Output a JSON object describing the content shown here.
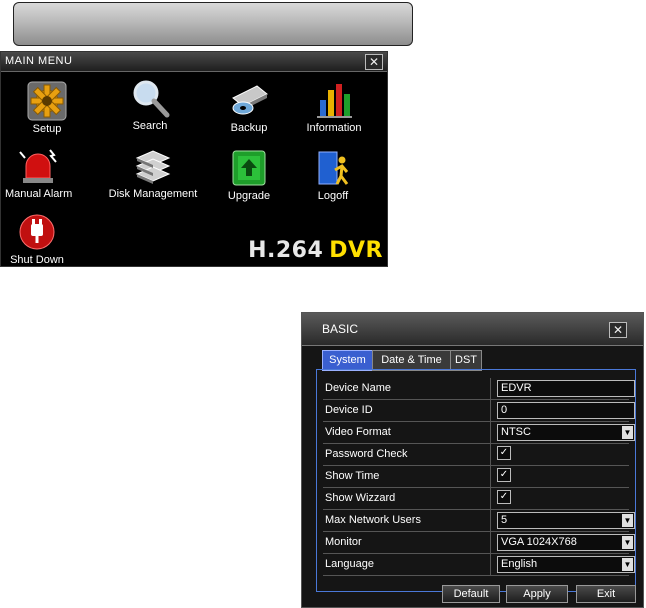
{
  "main_menu": {
    "title": "MAIN MENU",
    "close_glyph": "✕",
    "items": [
      {
        "label": "Setup",
        "icon": "gear-icon"
      },
      {
        "label": "Search",
        "icon": "magnifier-icon"
      },
      {
        "label": "Backup",
        "icon": "backup-disc-icon"
      },
      {
        "label": "Information",
        "icon": "bar-chart-icon"
      },
      {
        "label": "Manual Alarm",
        "icon": "siren-icon"
      },
      {
        "label": "Disk Management",
        "icon": "disk-stack-icon"
      },
      {
        "label": "Upgrade",
        "icon": "upgrade-arrow-icon"
      },
      {
        "label": "Logoff",
        "icon": "logoff-door-icon"
      },
      {
        "label": "Shut Down",
        "icon": "power-plug-icon"
      }
    ],
    "logo_main": "H.264",
    "logo_accent": "DVR"
  },
  "basic": {
    "title": "BASIC",
    "close_glyph": "✕",
    "tabs": [
      "System",
      "Date & Time",
      "DST"
    ],
    "active_tab": "System",
    "fields": {
      "device_name": {
        "label": "Device Name",
        "value": "EDVR"
      },
      "device_id": {
        "label": "Device ID",
        "value": "0"
      },
      "video_format": {
        "label": "Video Format",
        "value": "NTSC"
      },
      "password_check": {
        "label": "Password Check",
        "checked": true
      },
      "show_time": {
        "label": "Show Time",
        "checked": true
      },
      "show_wizzard": {
        "label": "Show Wizzard",
        "checked": true
      },
      "max_network_users": {
        "label": "Max Network Users",
        "value": "5"
      },
      "monitor": {
        "label": "Monitor",
        "value": "VGA 1024X768"
      },
      "language": {
        "label": "Language",
        "value": "English"
      }
    },
    "check_glyph": "✓",
    "dropdown_glyph": "▼",
    "buttons": {
      "default": "Default",
      "apply": "Apply",
      "exit": "Exit"
    }
  },
  "colors": {
    "accent_blue": "#3a5fd0",
    "logo_yellow": "#ffe000",
    "alarm_red": "#d01010",
    "upgrade_green": "#1e9e2a"
  }
}
